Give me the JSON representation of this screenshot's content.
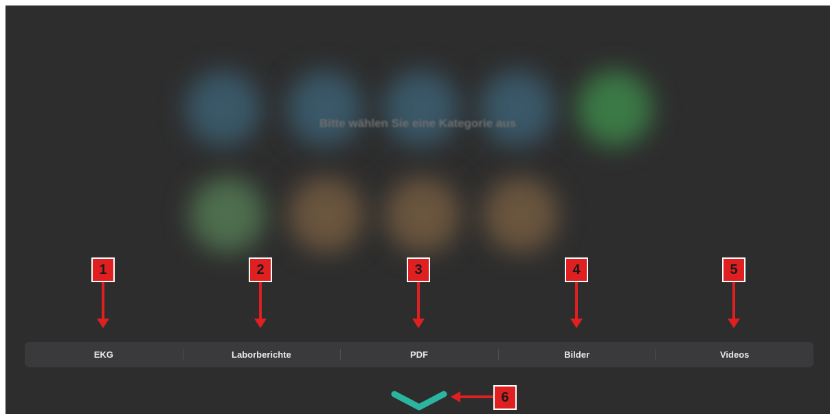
{
  "prompt": "Bitte wählen Sie eine Kategorie aus",
  "tabs": [
    {
      "label": "EKG"
    },
    {
      "label": "Laborberichte"
    },
    {
      "label": "PDF"
    },
    {
      "label": "Bilder"
    },
    {
      "label": "Videos"
    }
  ],
  "callouts": [
    "1",
    "2",
    "3",
    "4",
    "5",
    "6"
  ],
  "icons": {
    "collapse": "chevron-down-icon"
  },
  "colors": {
    "background": "#2d2d2d",
    "tabbar": "#3a3a3c",
    "callout": "#e02020",
    "chevron": "#2bb5a0"
  }
}
